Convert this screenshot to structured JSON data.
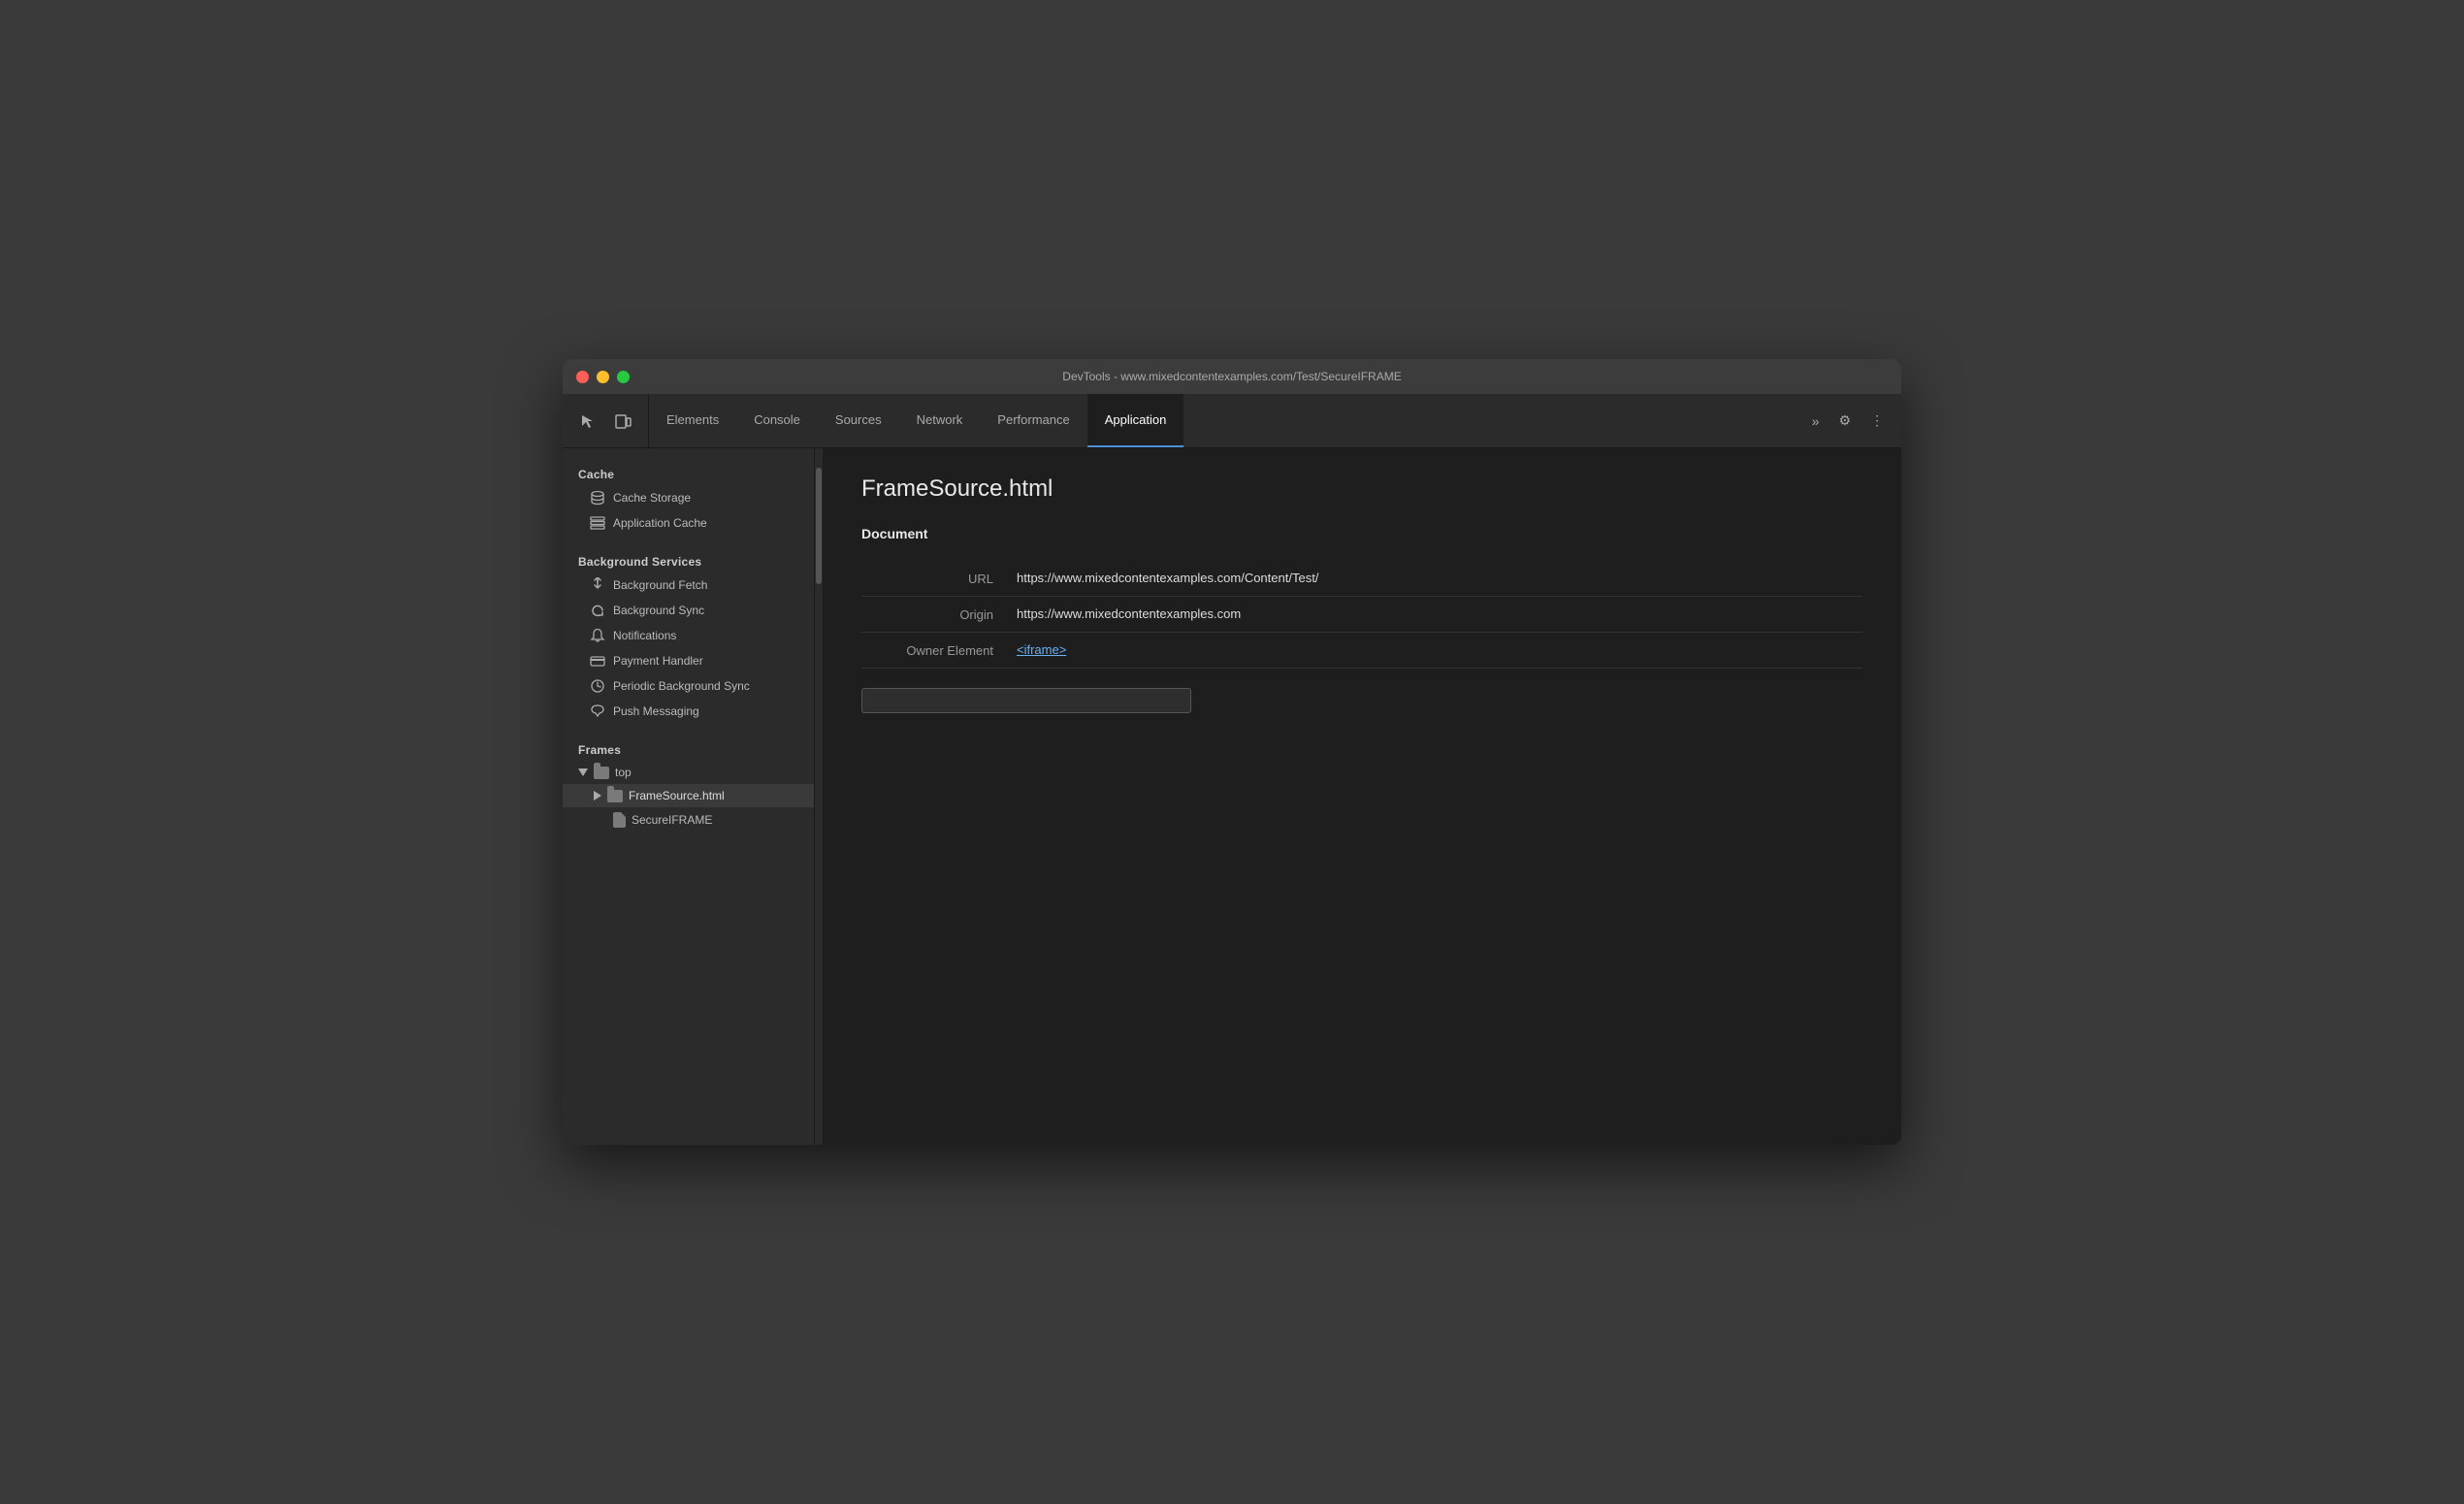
{
  "titlebar": {
    "title": "DevTools - www.mixedcontentexamples.com/Test/SecureIFRAME"
  },
  "toolbar": {
    "tabs": [
      {
        "id": "elements",
        "label": "Elements",
        "active": false
      },
      {
        "id": "console",
        "label": "Console",
        "active": false
      },
      {
        "id": "sources",
        "label": "Sources",
        "active": false
      },
      {
        "id": "network",
        "label": "Network",
        "active": false
      },
      {
        "id": "performance",
        "label": "Performance",
        "active": false
      },
      {
        "id": "application",
        "label": "Application",
        "active": true
      }
    ],
    "more_label": "»",
    "settings_icon": "⚙",
    "overflow_icon": "⋮"
  },
  "sidebar": {
    "sections": [
      {
        "id": "cache",
        "header": "Cache",
        "items": [
          {
            "id": "cache-storage",
            "label": "Cache Storage",
            "icon": "db"
          },
          {
            "id": "application-cache",
            "label": "Application Cache",
            "icon": "grid"
          }
        ]
      },
      {
        "id": "background-services",
        "header": "Background Services",
        "items": [
          {
            "id": "background-fetch",
            "label": "Background Fetch",
            "icon": "arrows"
          },
          {
            "id": "background-sync",
            "label": "Background Sync",
            "icon": "sync"
          },
          {
            "id": "notifications",
            "label": "Notifications",
            "icon": "bell"
          },
          {
            "id": "payment-handler",
            "label": "Payment Handler",
            "icon": "card"
          },
          {
            "id": "periodic-background-sync",
            "label": "Periodic Background Sync",
            "icon": "clock"
          },
          {
            "id": "push-messaging",
            "label": "Push Messaging",
            "icon": "cloud"
          }
        ]
      },
      {
        "id": "frames",
        "header": "Frames"
      }
    ],
    "frames_tree": {
      "top": {
        "label": "top",
        "children": [
          {
            "label": "FrameSource.html",
            "selected": true,
            "children": [
              {
                "label": "SecureIFRAME"
              }
            ]
          }
        ]
      }
    }
  },
  "content": {
    "title": "FrameSource.html",
    "document_section": "Document",
    "fields": [
      {
        "label": "URL",
        "value": "https://www.mixedcontentexamples.com/Content/Test/",
        "type": "text"
      },
      {
        "label": "Origin",
        "value": "https://www.mixedcontentexamples.com",
        "type": "text"
      },
      {
        "label": "Owner Element",
        "value": "<iframe>",
        "type": "link"
      }
    ]
  }
}
